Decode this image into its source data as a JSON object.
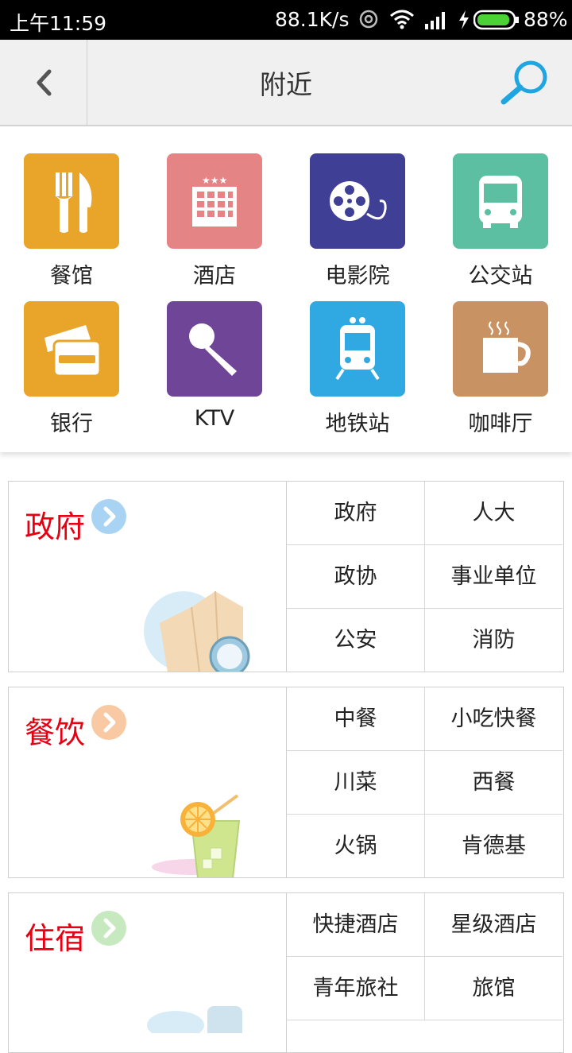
{
  "status_bar": {
    "time": "上午11:59",
    "speed": "88.1K/s",
    "battery": "88%"
  },
  "header": {
    "title": "附近"
  },
  "quick_categories": [
    {
      "label": "餐馆",
      "icon": "restaurant-icon",
      "color": "#E8A52A"
    },
    {
      "label": "酒店",
      "icon": "hotel-icon",
      "color": "#E58484"
    },
    {
      "label": "电影院",
      "icon": "cinema-icon",
      "color": "#3F3F96"
    },
    {
      "label": "公交站",
      "icon": "bus-icon",
      "color": "#5CBFA1"
    },
    {
      "label": "银行",
      "icon": "bank-card-icon",
      "color": "#E8A52A"
    },
    {
      "label": "KTV",
      "icon": "microphone-icon",
      "color": "#6F4697"
    },
    {
      "label": "地铁站",
      "icon": "subway-icon",
      "color": "#30A8E2"
    },
    {
      "label": "咖啡厅",
      "icon": "coffee-icon",
      "color": "#C99262"
    }
  ],
  "pager": {
    "pages": 2,
    "current": 1
  },
  "sections": [
    {
      "title": "政府",
      "arrow_color": "#A8D3F2",
      "items": [
        "政府",
        "人大",
        "政协",
        "事业单位",
        "公安",
        "消防"
      ]
    },
    {
      "title": "餐饮",
      "arrow_color": "#F9C9A4",
      "items": [
        "中餐",
        "小吃快餐",
        "川菜",
        "西餐",
        "火锅",
        "肯德基"
      ]
    },
    {
      "title": "住宿",
      "arrow_color": "#C6E9C0",
      "items": [
        "快捷酒店",
        "星级酒店",
        "青年旅社",
        "旅馆"
      ]
    }
  ]
}
